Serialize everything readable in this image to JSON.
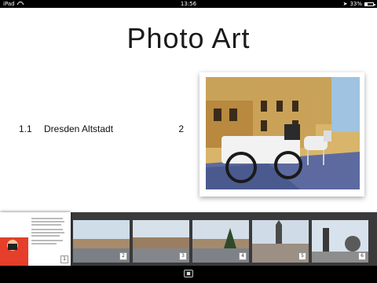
{
  "status": {
    "device": "iPad",
    "time": "13:56",
    "battery": "33%",
    "battery_level": 0.33,
    "wifi_icon": "wifi-icon",
    "location_icon": "location-arrow-icon"
  },
  "page": {
    "title": "Photo Art"
  },
  "toc": [
    {
      "number": "1.1",
      "label": "Dresden Altstadt",
      "page": "2"
    }
  ],
  "thumbnails": [
    {
      "page": "1"
    },
    {
      "page": "2"
    },
    {
      "page": "3"
    },
    {
      "page": "4"
    },
    {
      "page": "5"
    },
    {
      "page": "6"
    }
  ],
  "bottombar": {
    "control_icon": "play-icon"
  }
}
